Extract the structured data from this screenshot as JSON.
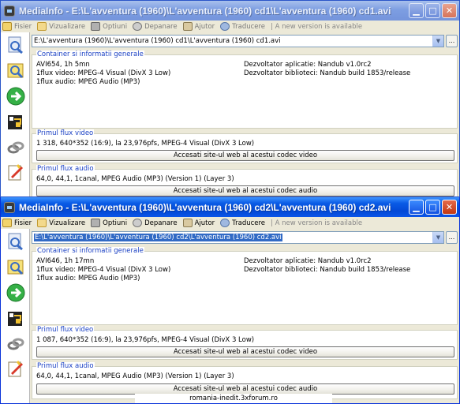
{
  "colors": {
    "title_active": "#0a5be6",
    "title_inactive": "#7d9ee2",
    "group_title": "#1c42c4",
    "selection": "#316ac5"
  },
  "menu": [
    {
      "label": "Fisier",
      "icon": "open-file-icon"
    },
    {
      "label": "Vizualizare",
      "icon": "view-icon"
    },
    {
      "label": "Optiuni",
      "icon": "options-icon"
    },
    {
      "label": "Depanare",
      "icon": "debug-icon"
    },
    {
      "label": "Ajutor",
      "icon": "help-icon"
    },
    {
      "label": "Traducere",
      "icon": "translate-icon"
    }
  ],
  "new_version": "| A new version is available",
  "sidebar_icons": [
    "open-file-icon",
    "search-icon",
    "next-icon",
    "export-icon",
    "link-icon",
    "edit-icon"
  ],
  "windows": [
    {
      "title": "MediaInfo - E:\\L'avventura (1960)\\L'avventura (1960) cd1\\L'avventura (1960)  cd1.avi",
      "path": "E:\\L'avventura (1960)\\L'avventura (1960) cd1\\L'avventura (1960)  cd1.avi",
      "general": {
        "title": "Container si informatii generale",
        "lines": [
          "AVI654, 1h 5mn",
          "1flux video: MPEG-4 Visual (DivX 3 Low)",
          "1flux audio: MPEG Audio (MP3)"
        ],
        "right": [
          "Dezvoltator aplicatie: Nandub v1.0rc2",
          "Dezvoltator biblioteci: Nandub build 1853/release"
        ]
      },
      "video": {
        "title": "Primul flux video",
        "line": "1 318, 640*352 (16:9), la 23,976pfs, MPEG-4 Visual (DivX 3 Low)",
        "button": "Accesati site-ul web al acestui codec video"
      },
      "audio": {
        "title": "Primul flux audio",
        "line": "64,0, 44,1, 1canal, MPEG Audio (MP3) (Version 1) (Layer 3)",
        "button": "Accesati site-ul web al acestui codec audio"
      }
    },
    {
      "title": "MediaInfo - E:\\L'avventura (1960)\\L'avventura (1960) cd2\\L'avventura (1960)  cd2.avi",
      "path": "E:\\L'avventura (1960)\\L'avventura (1960) cd2\\L'avventura (1960)  cd2.avi",
      "general": {
        "title": "Container si informatii generale",
        "lines": [
          "AVI646, 1h 17mn",
          "1flux video: MPEG-4 Visual (DivX 3 Low)",
          "1flux audio: MPEG Audio (MP3)"
        ],
        "right": [
          "Dezvoltator aplicatie: Nandub v1.0rc2",
          "Dezvoltator biblioteci: Nandub build 1853/release"
        ]
      },
      "video": {
        "title": "Primul flux video",
        "line": "1 087, 640*352 (16:9), la 23,976pfs, MPEG-4 Visual (DivX 3 Low)",
        "button": "Accesati site-ul web al acestui codec video"
      },
      "audio": {
        "title": "Primul flux audio",
        "line": "64,0, 44,1, 1canal, MPEG Audio (MP3) (Version 1) (Layer 3)",
        "button": "Accesati site-ul web al acestui codec audio"
      }
    }
  ],
  "watermark": "romania-inedit.3xforum.ro"
}
